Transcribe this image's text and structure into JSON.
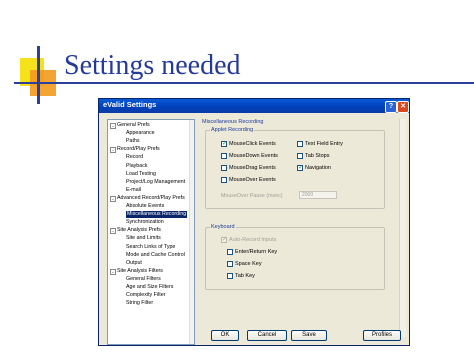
{
  "slide": {
    "title": "Settings needed"
  },
  "window": {
    "title": "eValid Settings",
    "help_glyph": "?",
    "close_glyph": "✕"
  },
  "tree": {
    "items": [
      {
        "label": "General Prefs",
        "expander": "–"
      },
      {
        "label": "Appearance"
      },
      {
        "label": "Paths"
      },
      {
        "label": "Record/Play Prefs",
        "expander": "–"
      },
      {
        "label": "Record"
      },
      {
        "label": "Playback"
      },
      {
        "label": "Load Testing"
      },
      {
        "label": "Project/Log Management"
      },
      {
        "label": "E-mail"
      },
      {
        "label": "Advanced Record/Play Prefs",
        "expander": "–"
      },
      {
        "label": "Absolute Events"
      },
      {
        "label": "Miscellaneous Recording",
        "selected": true
      },
      {
        "label": "Synchronization"
      },
      {
        "label": "Site Analysis Prefs",
        "expander": "–"
      },
      {
        "label": "Site and Limits"
      },
      {
        "label": "Search Links of Type"
      },
      {
        "label": "Mode and Cache Control"
      },
      {
        "label": "Output"
      },
      {
        "label": "Site Analysis Filters",
        "expander": "–"
      },
      {
        "label": "General Filters"
      },
      {
        "label": "Age and Size Filters"
      },
      {
        "label": "Complexity Filter"
      },
      {
        "label": "String Filter"
      }
    ]
  },
  "panel": {
    "title": "Miscellaneous Recording",
    "applet": {
      "label": "Applet Recording",
      "checks": [
        {
          "label": "MouseClick Events",
          "checked": true
        },
        {
          "label": "Text Field Entry",
          "checked": false
        },
        {
          "label": "MouseDown Events",
          "checked": false
        },
        {
          "label": "Tab Stops",
          "checked": false
        },
        {
          "label": "MouseDrag Events",
          "checked": false
        },
        {
          "label": "Navigation",
          "checked": true
        },
        {
          "label": "MouseOver Events",
          "checked": false
        }
      ],
      "pause_label": "MouseOver Pause (msec)",
      "pause_value": "2000"
    },
    "keyboard": {
      "label": "Keyboard",
      "auto_record": {
        "label": "Auto-Record Inputs",
        "checked": true
      },
      "checks": [
        {
          "label": "Enter/Return Key",
          "checked": false
        },
        {
          "label": "Space Key",
          "checked": false
        },
        {
          "label": "Tab Key",
          "checked": false
        }
      ]
    }
  },
  "buttons": {
    "ok": "OK",
    "cancel": "Cancel",
    "save": "Save",
    "profiles": "Profiles"
  },
  "check_glyph": "✓"
}
